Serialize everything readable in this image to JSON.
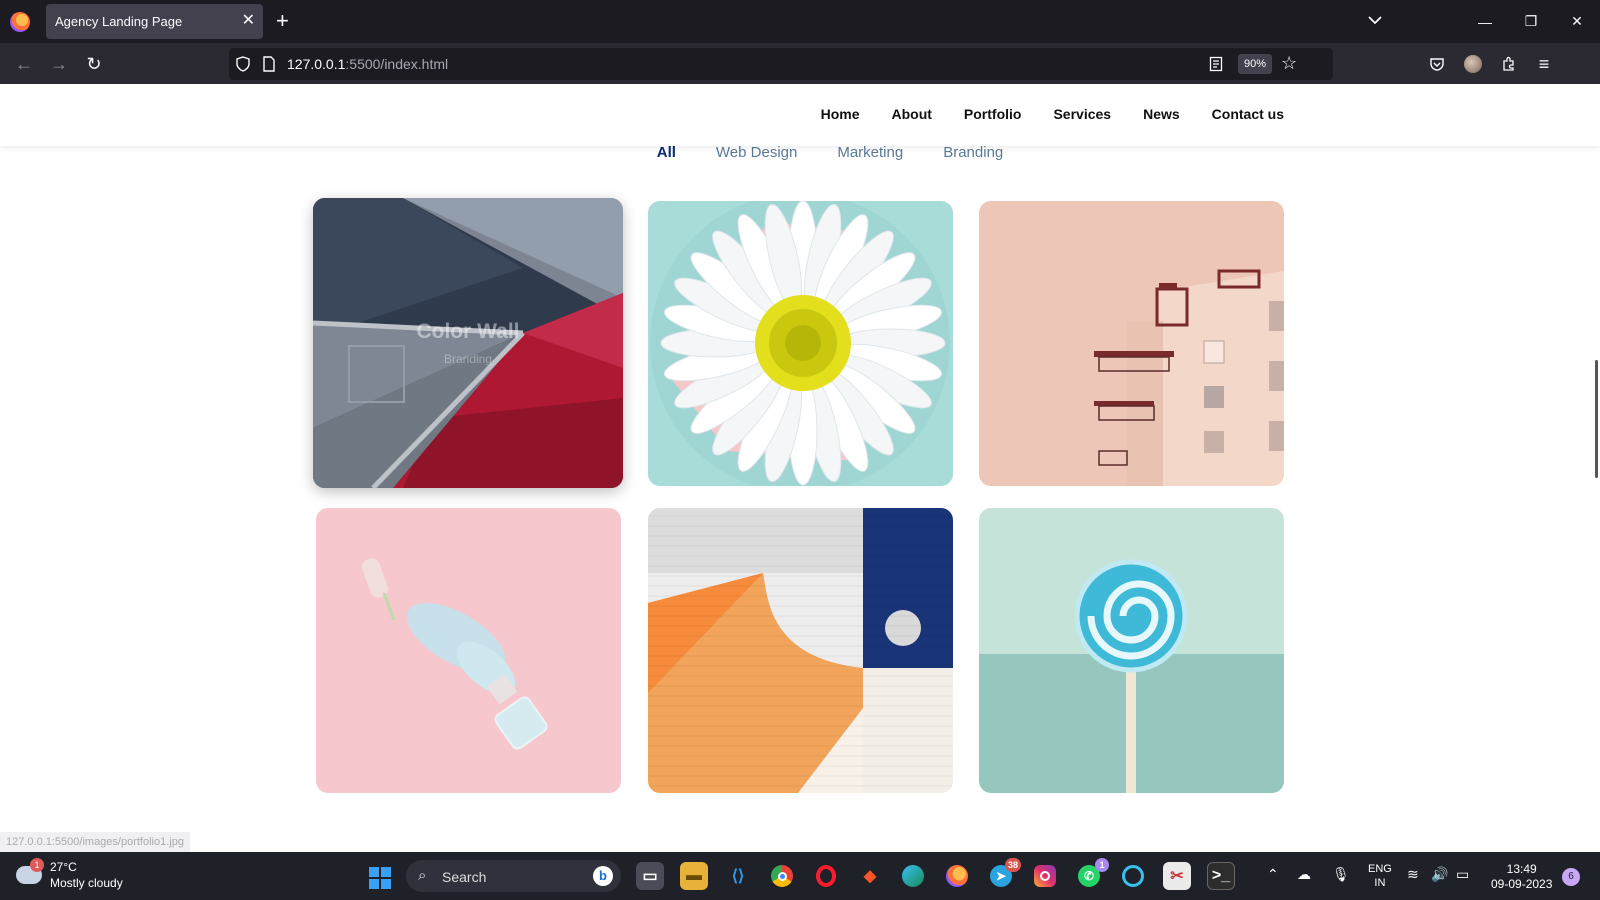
{
  "browser": {
    "tab_title": "Agency Landing Page",
    "tab_close": "✕",
    "new_tab": "+",
    "url_host": "127.0.0.1",
    "url_path": ":5500/index.html",
    "zoom": "90%"
  },
  "site": {
    "nav": [
      "Home",
      "About",
      "Portfolio",
      "Services",
      "News",
      "Contact us"
    ],
    "filters": [
      "All",
      "Web Design",
      "Marketing",
      "Branding"
    ],
    "active_filter": "All",
    "hover_card": {
      "title": "Color Wall",
      "category": "Branding"
    },
    "status_link": "127.0.0.1:5500/images/portfolio1.jpg"
  },
  "taskbar": {
    "weather_temp": "27°C",
    "weather_desc": "Mostly cloudy",
    "weather_badge": "1",
    "search_label": "Search",
    "telegram_badge": "38",
    "whatsapp_badge": "1",
    "lang_line1": "ENG",
    "lang_line2": "IN",
    "time": "13:49",
    "date": "09-09-2023",
    "notifications": "6"
  },
  "colors": {
    "brand_navy": "#0a2d6c",
    "filter_inactive": "#5a7a9a",
    "tabbar_bg": "#1c1b22",
    "navbar_bg": "#2b2a33"
  }
}
